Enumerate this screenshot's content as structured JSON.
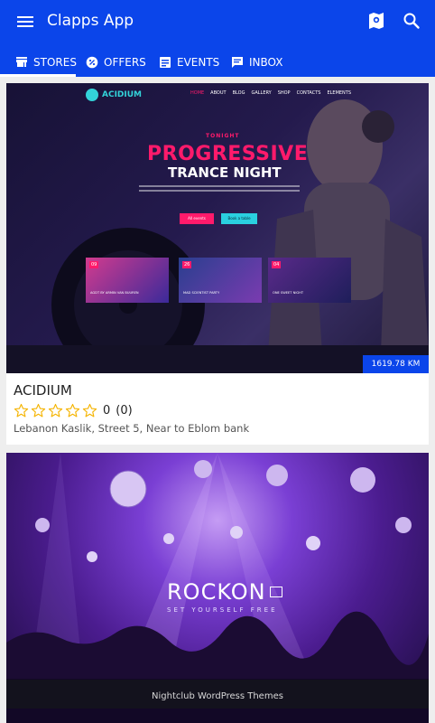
{
  "app": {
    "title": "Clapps App"
  },
  "tabs": [
    {
      "label": "STORES",
      "icon": "store-icon"
    },
    {
      "label": "OFFERS",
      "icon": "offers-icon"
    },
    {
      "label": "EVENTS",
      "icon": "events-icon"
    },
    {
      "label": "INBOX",
      "icon": "inbox-icon"
    }
  ],
  "colors": {
    "primary": "#0b45ea",
    "accent_pink": "#ff1a6b",
    "star_outline": "#f5b400"
  },
  "stores": [
    {
      "name": "ACIDIUM",
      "rating_value": "0",
      "rating_count": "(0)",
      "stars_filled": 0,
      "address": "Lebanon Kaslik, Street 5, Near to Eblom bank",
      "distance": "1619.78 KM",
      "image": {
        "logo": "ACIDIUM",
        "nav": [
          "HOME",
          "ABOUT",
          "BLOG",
          "GALLERY",
          "SHOP",
          "CONTACTS",
          "ELEMENTS"
        ],
        "kicker": "TONIGHT",
        "headline1": "PROGRESSIVE",
        "headline2": "TRANCE NIGHT",
        "btn1": "All events",
        "btn2": "Book a table",
        "events": [
          {
            "date": "09",
            "title": "AGDT BY ARMIN VAN BUUREN"
          },
          {
            "date": "26",
            "title": "MAD SCIENTIST PARTY"
          },
          {
            "date": "04",
            "title": "ONE SWEET NIGHT"
          }
        ]
      }
    },
    {
      "image": {
        "logo": "ROCKON",
        "tagline": "SET YOURSELF FREE",
        "caption": "Nightclub WordPress Themes"
      }
    }
  ]
}
